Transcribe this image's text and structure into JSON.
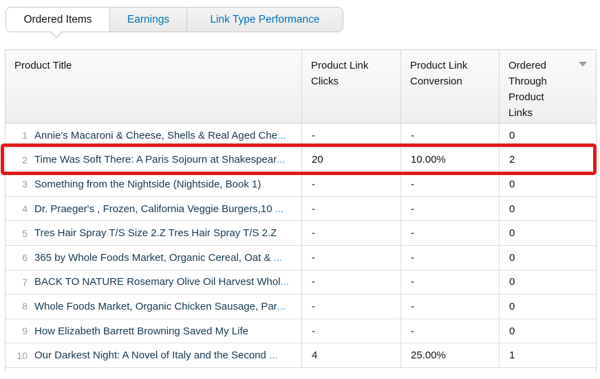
{
  "tabs": [
    {
      "label": "Ordered Items",
      "active": true
    },
    {
      "label": "Earnings",
      "active": false
    },
    {
      "label": "Link Type Performance",
      "active": false
    }
  ],
  "table": {
    "columns": [
      "Product Title",
      "Product Link Clicks",
      "Product Link Conversion",
      "Ordered Through Product Links"
    ],
    "sort": {
      "column": "Ordered Through Product Links",
      "direction": "descending"
    },
    "ellipsis": "...",
    "rows": [
      {
        "num": "1",
        "title": "Annie's Macaroni & Cheese, Shells & Real Aged Che",
        "truncated": true,
        "clicks": "-",
        "conversion": "-",
        "ordered": "0",
        "highlighted": false
      },
      {
        "num": "2",
        "title": "Time Was Soft There: A Paris Sojourn at Shakespear",
        "truncated": true,
        "clicks": "20",
        "conversion": "10.00%",
        "ordered": "2",
        "highlighted": true
      },
      {
        "num": "3",
        "title": "Something from the Nightside (Nightside, Book 1)",
        "truncated": false,
        "clicks": "-",
        "conversion": "-",
        "ordered": "0",
        "highlighted": false
      },
      {
        "num": "4",
        "title": "Dr. Praeger's , Frozen, California Veggie Burgers,10 ",
        "truncated": true,
        "clicks": "-",
        "conversion": "-",
        "ordered": "0",
        "highlighted": false
      },
      {
        "num": "5",
        "title": "Tres Hair Spray T/S Size 2.Z Tres Hair Spray T/S 2.Z",
        "truncated": false,
        "clicks": "-",
        "conversion": "-",
        "ordered": "0",
        "highlighted": false
      },
      {
        "num": "6",
        "title": "365 by Whole Foods Market, Organic Cereal, Oat & ",
        "truncated": true,
        "clicks": "-",
        "conversion": "-",
        "ordered": "0",
        "highlighted": false
      },
      {
        "num": "7",
        "title": "BACK TO NATURE Rosemary Olive Oil Harvest Whol",
        "truncated": true,
        "clicks": "-",
        "conversion": "-",
        "ordered": "0",
        "highlighted": false
      },
      {
        "num": "8",
        "title": "Whole Foods Market, Organic Chicken Sausage, Par",
        "truncated": true,
        "clicks": "-",
        "conversion": "-",
        "ordered": "0",
        "highlighted": false
      },
      {
        "num": "9",
        "title": "How Elizabeth Barrett Browning Saved My Life",
        "truncated": false,
        "clicks": "-",
        "conversion": "-",
        "ordered": "0",
        "highlighted": false
      },
      {
        "num": "10",
        "title": "Our Darkest Night: A Novel of Italy and the Second ",
        "truncated": true,
        "clicks": "4",
        "conversion": "25.00%",
        "ordered": "1",
        "highlighted": false
      }
    ]
  },
  "highlight": {
    "row_number": "2"
  },
  "colors": {
    "tab_link_blue": "#0073bb",
    "title_text": "#15384f",
    "ellipsis_blue": "#2e8fd6",
    "highlight_red": "#e01b1b",
    "row_number_gray": "#9c9c9c",
    "border_gray": "#d2d2d2"
  }
}
